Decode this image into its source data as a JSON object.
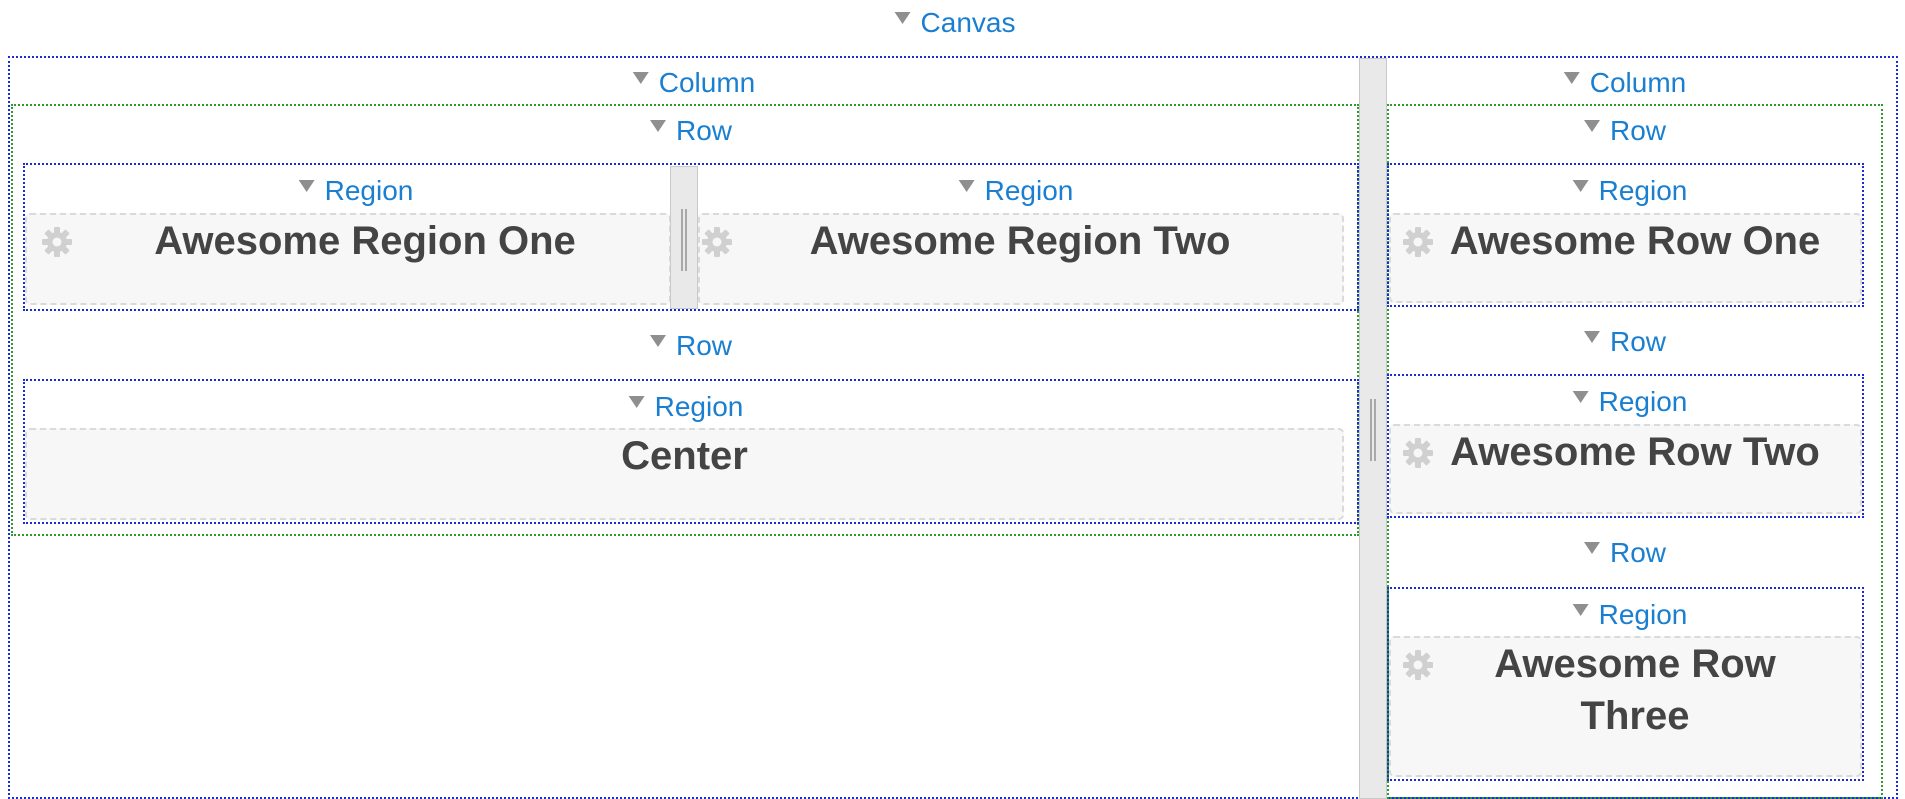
{
  "canvas": {
    "label": "Canvas"
  },
  "left_column": {
    "label": "Column",
    "row1": {
      "label": "Row",
      "region1": {
        "label": "Region",
        "title": "Awesome Region One",
        "icon": "gear-icon"
      },
      "region2": {
        "label": "Region",
        "title": "Awesome Region Two",
        "icon": "gear-icon"
      }
    },
    "row2": {
      "label": "Row",
      "region": {
        "label": "Region",
        "title": "Center"
      }
    }
  },
  "right_column": {
    "label": "Column",
    "rows": [
      {
        "label": "Row",
        "region_label": "Region",
        "title": "Awesome Row One",
        "icon": "gear-icon"
      },
      {
        "label": "Row",
        "region_label": "Region",
        "title": "Awesome Row Two",
        "icon": "gear-icon"
      },
      {
        "label": "Row",
        "region_label": "Region",
        "title_line1": "Awesome Row",
        "title_line2": "Three",
        "icon": "gear-icon"
      }
    ]
  },
  "colors": {
    "link": "#1a7fd0",
    "canvas_border": "#1c2bd6",
    "column_border": "#2c9a2c",
    "region_bg": "#f7f7f7",
    "title_text": "#444444"
  }
}
